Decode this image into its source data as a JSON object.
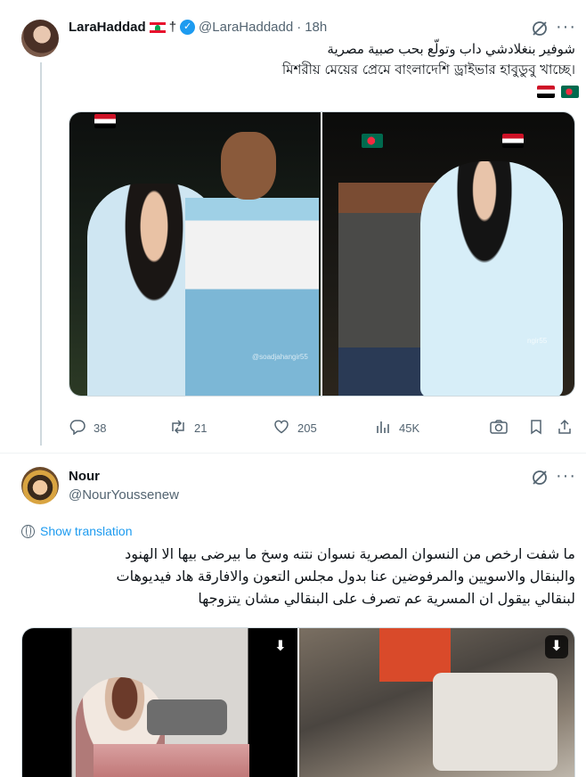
{
  "tweet1": {
    "author_name": "LaraHaddad",
    "author_suffix": "†",
    "handle": "@LaraHaddadd",
    "separator": "·",
    "time": "18h",
    "text_arabic": "شوفير بنغلادشي داب وتولّع بحب صبية مصرية",
    "text_bengali": "মিশরীয় মেয়ের প্রেমে বাংলাদেশি ড্রাইভার হাবুডুবু খাচ্ছে।",
    "watermark": "@soadjahangir55",
    "watermark_right": "ngir55",
    "actions": {
      "replies": "38",
      "reposts": "21",
      "likes": "205",
      "views": "45K"
    }
  },
  "tweet2": {
    "author_name": "Nour",
    "handle": "@NourYoussenew",
    "translate_label": "Show translation",
    "text_line1": "ما شفت ارخص من النسوان المصرية نسوان نتنه وسخ ما بيرضى بيها الا الهنود",
    "text_line2": "والبنقال والاسويين والمرفوضين عنا بدول مجلس التعون والافارقة هاد فيديوهات",
    "text_line3": "لبنقالي بيقول ان المسرية عم تصرف على البنقالي مشان يتزوجها"
  },
  "icons": {
    "verified": "verified-badge-icon",
    "grok": "grok-icon",
    "more": "more-icon",
    "reply": "reply-icon",
    "repost": "repost-icon",
    "like": "heart-icon",
    "views": "views-icon",
    "camera": "camera-icon",
    "bookmark": "bookmark-icon",
    "share": "share-icon",
    "globe": "globe-icon",
    "download": "download-icon"
  },
  "colors": {
    "accent": "#1d9bf0",
    "muted": "#536471",
    "text": "#0f1419",
    "border": "#cfd9de"
  }
}
